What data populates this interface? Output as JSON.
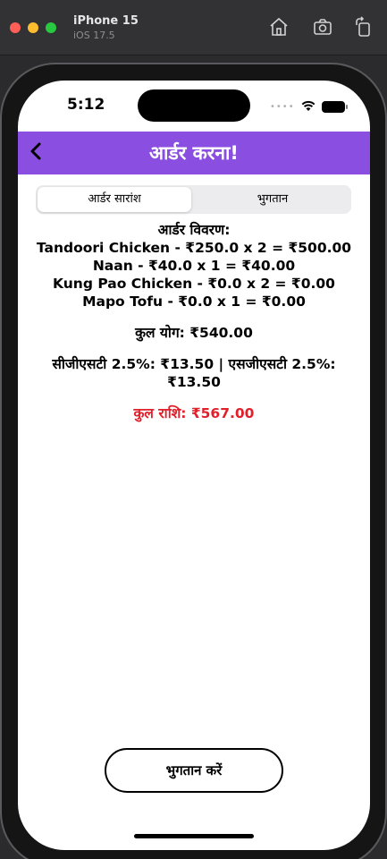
{
  "simulator": {
    "device_name": "iPhone 15",
    "os_version": "iOS 17.5",
    "icons": [
      "home-icon",
      "screenshot-icon",
      "rotate-icon"
    ]
  },
  "status_bar": {
    "time": "5:12",
    "signal_dots": "••••"
  },
  "nav": {
    "title": "आर्डर करना!",
    "back_icon": "chevron-left-icon",
    "color": "#8a4fe0"
  },
  "tabs": [
    {
      "label": "आर्डर सारांश",
      "selected": true
    },
    {
      "label": "भुगतान",
      "selected": false
    }
  ],
  "order": {
    "heading": "आर्डर विवरण:",
    "items": [
      "Tandoori Chicken - ₹250.0 x 2 = ₹500.00",
      "Naan - ₹40.0 x 1 = ₹40.00",
      "Kung Pao Chicken - ₹0.0 x 2 = ₹0.00",
      "Mapo Tofu - ₹0.0 x 1 = ₹0.00"
    ],
    "subtotal": "कुल योग: ₹540.00",
    "tax": "सीजीएसटी 2.5%: ₹13.50 | एसजीएसटी 2.5%: ₹13.50",
    "total": "कुल राशि: ₹567.00",
    "total_color": "#e0202a"
  },
  "pay_button": {
    "label": "भुगतान करें"
  }
}
